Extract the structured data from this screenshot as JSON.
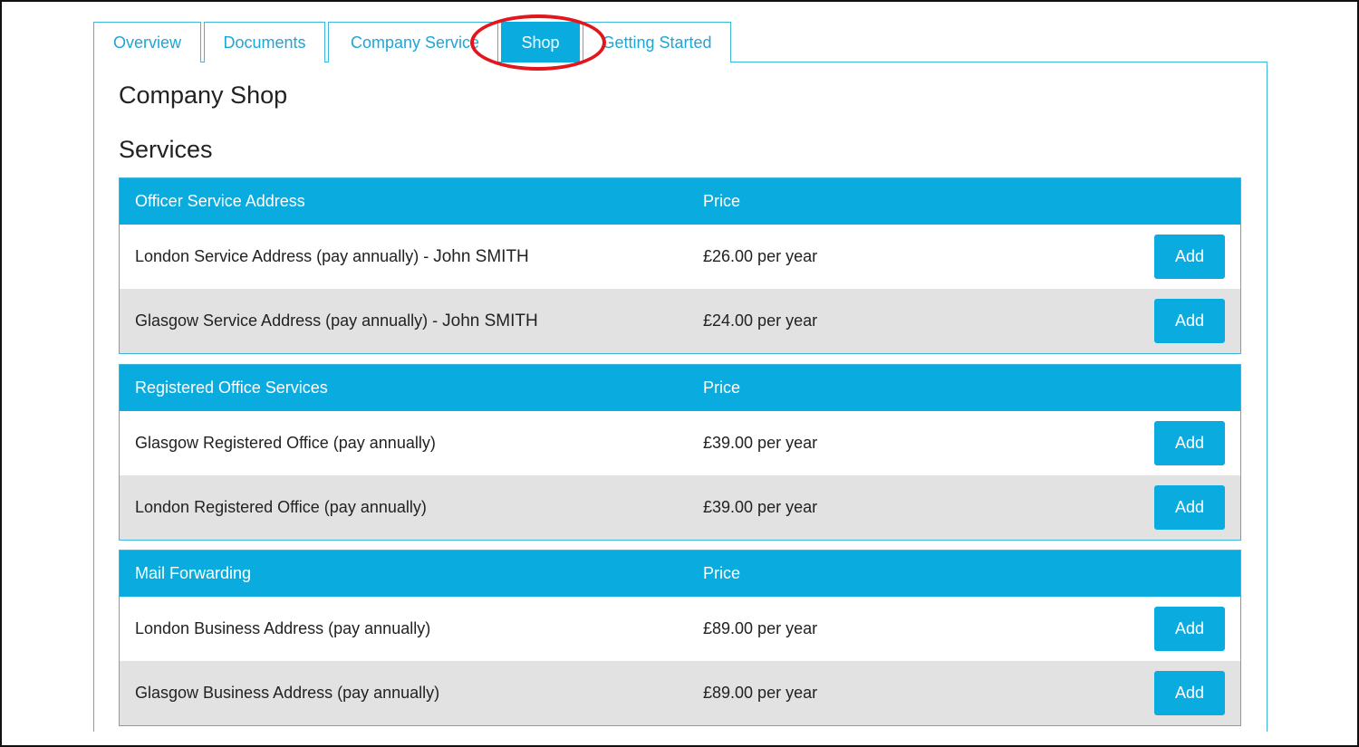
{
  "tabs": [
    {
      "label": "Overview",
      "active": false
    },
    {
      "label": "Documents",
      "active": false
    },
    {
      "label": "Company Service",
      "active": false
    },
    {
      "label": "Shop",
      "active": true
    },
    {
      "label": "Getting Started",
      "active": false
    }
  ],
  "page": {
    "title": "Company Shop",
    "section_title": "Services"
  },
  "groups": [
    {
      "name": "Officer Service Address",
      "price_header": "Price",
      "items": [
        {
          "name": "London Service Address (pay annually) - ",
          "person": "John SMITH",
          "price": "£26.00 per year",
          "button": "Add"
        },
        {
          "name": "Glasgow Service Address (pay annually) - ",
          "person": "John SMITH",
          "price": "£24.00 per year",
          "button": "Add"
        }
      ]
    },
    {
      "name": "Registered Office Services",
      "price_header": "Price",
      "items": [
        {
          "name": "Glasgow Registered Office (pay annually)",
          "price": "£39.00 per year",
          "button": "Add"
        },
        {
          "name": "London Registered Office (pay annually)",
          "price": "£39.00 per year",
          "button": "Add"
        }
      ]
    },
    {
      "name": "Mail Forwarding",
      "price_header": "Price",
      "items": [
        {
          "name": "London Business Address (pay annually)",
          "price": "£89.00 per year",
          "button": "Add"
        },
        {
          "name": "Glasgow Business Address (pay annually)",
          "price": "£89.00 per year",
          "button": "Add"
        }
      ]
    }
  ],
  "annotation": {
    "type": "highlight-ellipse",
    "target": "Shop",
    "color": "#e3161b"
  },
  "colors": {
    "accent": "#0aace0",
    "border": "#3fb7dc",
    "alt_row": "#e2e2e2",
    "tab_text": "#1ea6d6"
  }
}
